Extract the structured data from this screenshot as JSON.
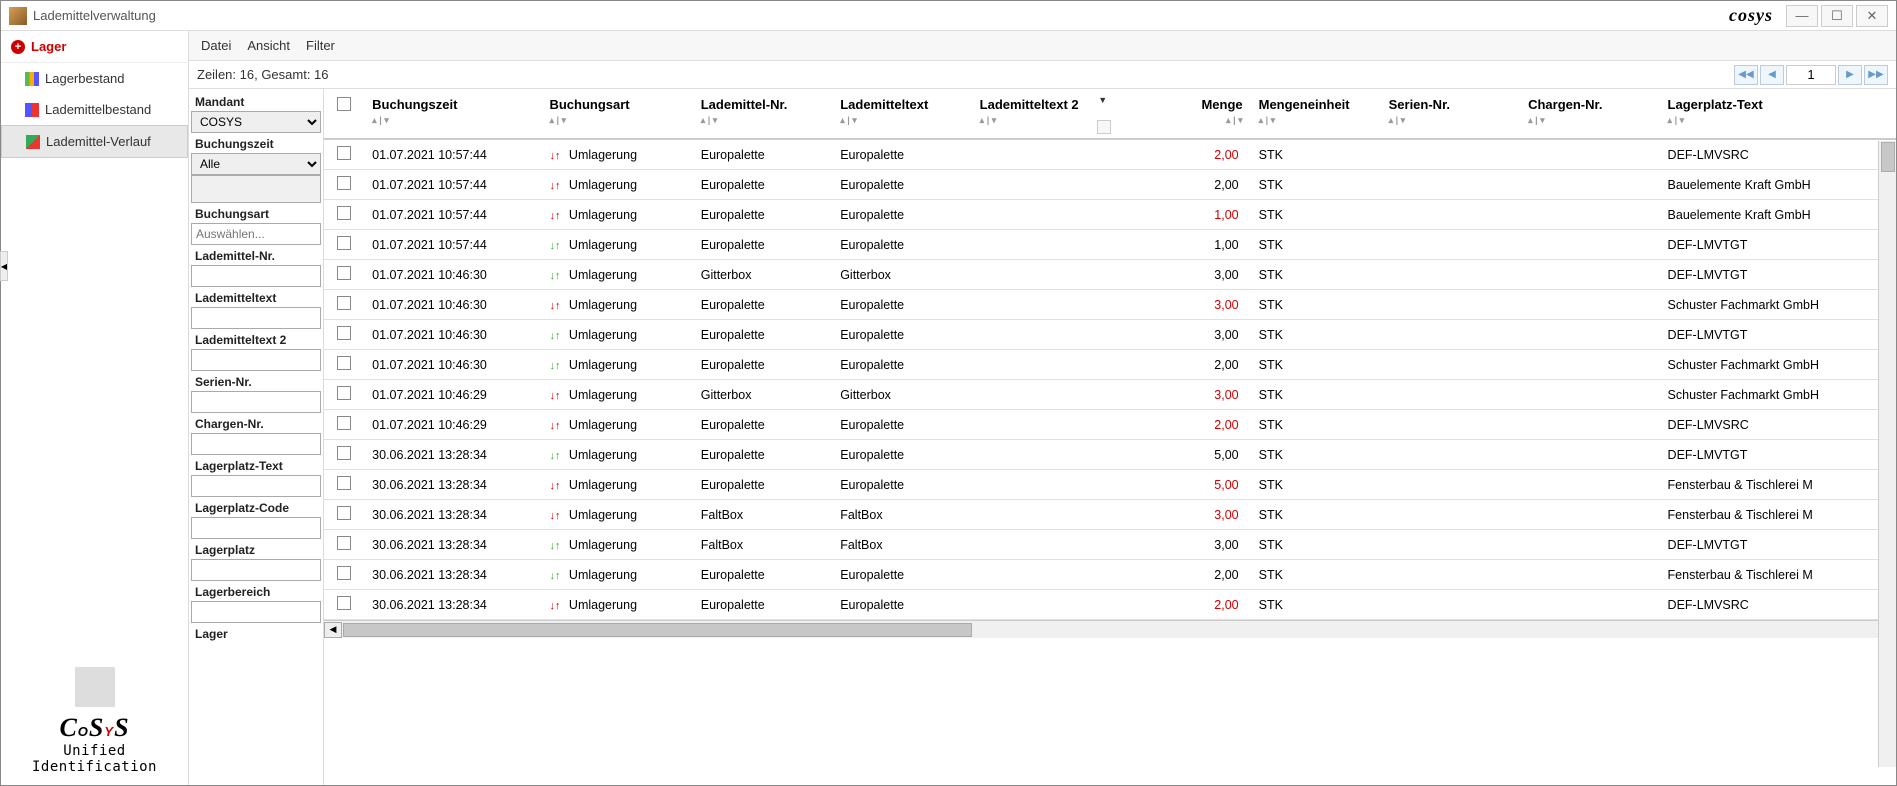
{
  "window": {
    "title": "Lademittelverwaltung"
  },
  "titlebar_logo": "cosys",
  "tree": {
    "header": "Lager",
    "items": [
      {
        "label": "Lagerbestand"
      },
      {
        "label": "Lademittelbestand"
      },
      {
        "label": "Lademittel-Verlauf"
      }
    ]
  },
  "brand": {
    "name": "COSYS",
    "sub": "Unified Identification"
  },
  "menu": {
    "datei": "Datei",
    "ansicht": "Ansicht",
    "filter": "Filter"
  },
  "status": {
    "text": "Zeilen: 16, Gesamt: 16"
  },
  "pager": {
    "page": "1"
  },
  "filters": {
    "mandant_label": "Mandant",
    "mandant_value": "COSYS",
    "buchungszeit_label": "Buchungszeit",
    "buchungszeit_value": "Alle",
    "buchungsart_label": "Buchungsart",
    "buchungsart_placeholder": "Auswählen...",
    "lademittelnr_label": "Lademittel-Nr.",
    "lademitteltext_label": "Lademitteltext",
    "lademitteltext2_label": "Lademitteltext 2",
    "seriennr_label": "Serien-Nr.",
    "chargennr_label": "Chargen-Nr.",
    "lagerplatztext_label": "Lagerplatz-Text",
    "lagerplatzcode_label": "Lagerplatz-Code",
    "lagerplatz_label": "Lagerplatz",
    "lagerbereich_label": "Lagerbereich",
    "lager_label": "Lager"
  },
  "columns": {
    "buchungszeit": "Buchungszeit",
    "buchungsart": "Buchungsart",
    "lademittelnr": "Lademittel-Nr.",
    "lademitteltext": "Lademitteltext",
    "lademitteltext2": "Lademitteltext 2",
    "menge": "Menge",
    "mengeneinheit": "Mengeneinheit",
    "seriennr": "Serien-Nr.",
    "chargennr": "Chargen-Nr.",
    "lagerplatztext": "Lagerplatz-Text"
  },
  "buchungsart_value": "Umlagerung",
  "rows": [
    {
      "zeit": "01.07.2021 10:57:44",
      "dir": "down",
      "nr": "Europalette",
      "text": "Europalette",
      "menge": "2,00",
      "red": true,
      "einheit": "STK",
      "platz": "DEF-LMVSRC"
    },
    {
      "zeit": "01.07.2021 10:57:44",
      "dir": "down",
      "nr": "Europalette",
      "text": "Europalette",
      "menge": "2,00",
      "red": false,
      "einheit": "STK",
      "platz": "Bauelemente Kraft GmbH"
    },
    {
      "zeit": "01.07.2021 10:57:44",
      "dir": "down",
      "nr": "Europalette",
      "text": "Europalette",
      "menge": "1,00",
      "red": true,
      "einheit": "STK",
      "platz": "Bauelemente Kraft GmbH"
    },
    {
      "zeit": "01.07.2021 10:57:44",
      "dir": "up",
      "nr": "Europalette",
      "text": "Europalette",
      "menge": "1,00",
      "red": false,
      "einheit": "STK",
      "platz": "DEF-LMVTGT"
    },
    {
      "zeit": "01.07.2021 10:46:30",
      "dir": "up",
      "nr": "Gitterbox",
      "text": "Gitterbox",
      "menge": "3,00",
      "red": false,
      "einheit": "STK",
      "platz": "DEF-LMVTGT"
    },
    {
      "zeit": "01.07.2021 10:46:30",
      "dir": "down",
      "nr": "Europalette",
      "text": "Europalette",
      "menge": "3,00",
      "red": true,
      "einheit": "STK",
      "platz": "Schuster Fachmarkt GmbH"
    },
    {
      "zeit": "01.07.2021 10:46:30",
      "dir": "up",
      "nr": "Europalette",
      "text": "Europalette",
      "menge": "3,00",
      "red": false,
      "einheit": "STK",
      "platz": "DEF-LMVTGT"
    },
    {
      "zeit": "01.07.2021 10:46:30",
      "dir": "up",
      "nr": "Europalette",
      "text": "Europalette",
      "menge": "2,00",
      "red": false,
      "einheit": "STK",
      "platz": "Schuster Fachmarkt GmbH"
    },
    {
      "zeit": "01.07.2021 10:46:29",
      "dir": "down",
      "nr": "Gitterbox",
      "text": "Gitterbox",
      "menge": "3,00",
      "red": true,
      "einheit": "STK",
      "platz": "Schuster Fachmarkt GmbH"
    },
    {
      "zeit": "01.07.2021 10:46:29",
      "dir": "down",
      "nr": "Europalette",
      "text": "Europalette",
      "menge": "2,00",
      "red": true,
      "einheit": "STK",
      "platz": "DEF-LMVSRC"
    },
    {
      "zeit": "30.06.2021 13:28:34",
      "dir": "up",
      "nr": "Europalette",
      "text": "Europalette",
      "menge": "5,00",
      "red": false,
      "einheit": "STK",
      "platz": "DEF-LMVTGT"
    },
    {
      "zeit": "30.06.2021 13:28:34",
      "dir": "down",
      "nr": "Europalette",
      "text": "Europalette",
      "menge": "5,00",
      "red": true,
      "einheit": "STK",
      "platz": "Fensterbau & Tischlerei M"
    },
    {
      "zeit": "30.06.2021 13:28:34",
      "dir": "down",
      "nr": "FaltBox",
      "text": "FaltBox",
      "menge": "3,00",
      "red": true,
      "einheit": "STK",
      "platz": "Fensterbau & Tischlerei M"
    },
    {
      "zeit": "30.06.2021 13:28:34",
      "dir": "up",
      "nr": "FaltBox",
      "text": "FaltBox",
      "menge": "3,00",
      "red": false,
      "einheit": "STK",
      "platz": "DEF-LMVTGT"
    },
    {
      "zeit": "30.06.2021 13:28:34",
      "dir": "up",
      "nr": "Europalette",
      "text": "Europalette",
      "menge": "2,00",
      "red": false,
      "einheit": "STK",
      "platz": "Fensterbau & Tischlerei M"
    },
    {
      "zeit": "30.06.2021 13:28:34",
      "dir": "down",
      "nr": "Europalette",
      "text": "Europalette",
      "menge": "2,00",
      "red": true,
      "einheit": "STK",
      "platz": "DEF-LMVSRC"
    }
  ]
}
